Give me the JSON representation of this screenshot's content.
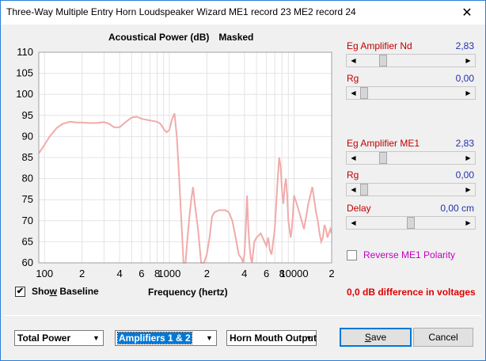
{
  "window": {
    "title": "Three-Way Multiple Entry Horn Loudspeaker Wizard   ME1 record 23   ME2 record 24"
  },
  "chart_data": {
    "type": "line",
    "title": "Acoustical Power (dB)",
    "title_suffix": "Masked",
    "xlabel": "Frequency (hertz)",
    "ylabel": "",
    "xscale": "log",
    "xlim": [
      90,
      20000
    ],
    "ylim": [
      60,
      110
    ],
    "yticks": [
      60,
      65,
      70,
      75,
      80,
      85,
      90,
      95,
      100,
      105,
      110
    ],
    "xtick_labels": [
      {
        "value": 100,
        "label": "100"
      },
      {
        "value": 200,
        "label": "2"
      },
      {
        "value": 400,
        "label": "4"
      },
      {
        "value": 600,
        "label": "6"
      },
      {
        "value": 800,
        "label": "8"
      },
      {
        "value": 1000,
        "label": "1000"
      },
      {
        "value": 2000,
        "label": "2"
      },
      {
        "value": 4000,
        "label": "4"
      },
      {
        "value": 6000,
        "label": "6"
      },
      {
        "value": 8000,
        "label": "8"
      },
      {
        "value": 10000,
        "label": "10000"
      },
      {
        "value": 20000,
        "label": "2"
      }
    ],
    "grid": true,
    "line_color": "#f2aaaa",
    "series": [
      {
        "x": [
          90,
          100,
          110,
          125,
          140,
          160,
          180,
          200,
          230,
          260,
          300,
          330,
          360,
          400,
          450,
          500,
          550,
          600,
          700,
          800,
          850,
          900,
          950,
          1000,
          1050,
          1100,
          1150,
          1200,
          1300,
          1350,
          1400,
          1450,
          1500,
          1550,
          1600,
          1700,
          1800,
          1900,
          2000,
          2100,
          2200,
          2300,
          2500,
          2800,
          3000,
          3200,
          3400,
          3600,
          3800,
          3900,
          4000,
          4100,
          4200,
          4300,
          4400,
          4500,
          4600,
          4800,
          5000,
          5200,
          5400,
          5600,
          5800,
          6000,
          6200,
          6400,
          6600,
          6800,
          7000,
          7200,
          7400,
          7600,
          7800,
          8000,
          8200,
          8400,
          8600,
          8800,
          9000,
          9200,
          9400,
          9600,
          9800,
          10000,
          10500,
          11000,
          11500,
          12000,
          12500,
          13000,
          13500,
          14000,
          14500,
          15000,
          15500,
          16000,
          16500,
          17000,
          17500,
          18000,
          18500,
          19000,
          19500,
          20000
        ],
        "values": [
          86,
          88,
          90,
          92,
          93,
          93.5,
          93.3,
          93.3,
          93.2,
          93.2,
          93.4,
          93,
          92.2,
          92.2,
          93.5,
          94.5,
          94.7,
          94.2,
          93.8,
          93.5,
          93,
          91.8,
          91,
          91.5,
          94,
          95.5,
          90,
          80,
          60,
          60,
          66,
          71,
          75,
          78,
          74,
          68,
          60,
          60,
          62,
          66,
          71,
          72,
          72.5,
          72.5,
          72,
          70,
          66,
          62,
          61,
          60,
          62,
          68,
          76,
          68,
          64,
          61,
          60,
          65,
          66,
          66.5,
          67,
          66,
          65,
          64,
          66,
          63,
          62,
          65,
          68,
          74,
          80,
          85,
          83,
          77,
          74,
          78,
          80,
          76,
          70,
          68,
          66,
          68,
          72,
          76,
          74,
          72,
          70,
          68,
          71,
          74,
          76,
          78,
          75,
          72,
          70,
          67,
          65,
          66,
          69,
          68,
          66,
          67,
          68,
          67
        ]
      }
    ]
  },
  "baseline": {
    "label_prefix": "Sho",
    "label_underline": "w",
    "label_suffix": " Baseline",
    "checked": true
  },
  "difference_text": "0,0 dB difference in voltages",
  "controls": {
    "eg_amp_nd": {
      "label": "Eg  Amplifier  Nd",
      "value": "2,83",
      "level": 0.2
    },
    "rg1": {
      "label": "Rg",
      "value": "0,00",
      "level": 0.0
    },
    "eg_amp_me1": {
      "label": "Eg  Amplifier  ME1",
      "value": "2,83",
      "level": 0.2
    },
    "rg2": {
      "label": "Rg",
      "value": "0,00",
      "level": 0.0
    },
    "delay": {
      "label": "Delay",
      "value": "0,00 cm",
      "level": 0.5
    }
  },
  "reverse": {
    "label": "Reverse ME1 Polarity",
    "checked": false
  },
  "bottom": {
    "total_power": "Total Power",
    "amplifiers": "Amplifiers 1 & 2",
    "horn_mouth": "Horn Mouth Output",
    "save_u": "S",
    "save_rest": "ave",
    "cancel": "Cancel"
  },
  "icons": {
    "close": "close-icon",
    "dropdown": "chevron-down-icon",
    "arrow_left": "arrow-left-icon",
    "arrow_right": "arrow-right-icon",
    "check": "check-icon"
  }
}
